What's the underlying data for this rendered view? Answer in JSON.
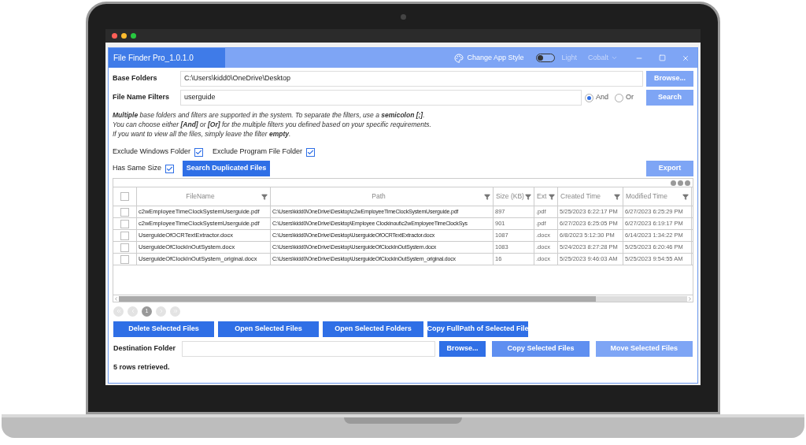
{
  "window": {
    "title": "File Finder Pro_1.0.1.0",
    "style_label": "Change App Style",
    "dark_mode": {
      "on": false,
      "label": "Light"
    },
    "theme": "Cobalt"
  },
  "base_folders": {
    "label": "Base Folders",
    "value": "C:\\Users\\kidd0\\OneDrive\\Desktop",
    "button": "Browse..."
  },
  "filters": {
    "label": "File Name Filters",
    "value": "userguide",
    "options": [
      {
        "label": "And",
        "selected": true
      },
      {
        "label": "Or",
        "selected": false
      }
    ],
    "button": "Search"
  },
  "help": [
    "**Multiple** base folders and filters are supported in the system. To separate the filters, use a **semicolon [;]**.",
    "You can choose either **[And]** or **[Or]** for the multiple filters you defined based on your specific requirements.",
    "If you want to view all the files, simply leave the filter **empty**."
  ],
  "excludes": [
    {
      "label": "Exclude Windows Folder",
      "checked": true
    },
    {
      "label": "Exclude Program File Folder",
      "checked": true
    }
  ],
  "same_size": {
    "label": "Has Same Size",
    "checked": true
  },
  "duplicate_button": "Search Duplicated Files",
  "export_button": "Export",
  "table": {
    "all_checked": false,
    "columns": [
      "FileName",
      "Path",
      "Size (KB)",
      "Ext",
      "Created Time",
      "Modified Time"
    ],
    "rows": [
      {
        "checked": false,
        "cells": [
          "c2wEmployeeTimeClockSystemUserguide.pdf",
          "C:\\Users\\kidd0\\OneDrive\\Desktop\\c2wEmployeeTimeClockSystemUserguide.pdf",
          "897",
          ".pdf",
          "5/25/2023 6:22:17 PM",
          "6/27/2023 6:25:29 PM"
        ]
      },
      {
        "checked": false,
        "cells": [
          "c2wEmployeeTimeClockSystemUserguide.pdf",
          "C:\\Users\\kidd0\\OneDrive\\Desktop\\Employee Clockinout\\c2wEmployeeTimeClockSys",
          "901",
          ".pdf",
          "6/27/2023 6:25:05 PM",
          "6/27/2023 6:19:17 PM"
        ]
      },
      {
        "checked": false,
        "cells": [
          "UserguideOfOCRTextExtractor.docx",
          "C:\\Users\\kidd0\\OneDrive\\Desktop\\UserguideOfOCRTextExtractor.docx",
          "1087",
          ".docx",
          "6/8/2023 5:12:30 PM",
          "6/14/2023 1:34:22 PM"
        ]
      },
      {
        "checked": false,
        "cells": [
          "UserguideOfClockInOutSystem.docx",
          "C:\\Users\\kidd0\\OneDrive\\Desktop\\UserguideOfClockInOutSystem.docx",
          "1083",
          ".docx",
          "5/24/2023 8:27:28 PM",
          "5/25/2023 6:20:46 PM"
        ]
      },
      {
        "checked": false,
        "cells": [
          "UserguideOfClockInOutSystem_original.docx",
          "C:\\Users\\kidd0\\OneDrive\\Desktop\\UserguideOfClockInOutSystem_original.docx",
          "16",
          ".docx",
          "5/25/2023 9:46:03 AM",
          "5/25/2023 9:54:55 AM"
        ]
      }
    ]
  },
  "pager": {
    "pages": [
      {
        "label": "1",
        "selected": true
      }
    ]
  },
  "actions": [
    "Delete Selected Files",
    "Open Selected Files",
    "Open Selected Folders",
    "Copy FullPath of Selected File"
  ],
  "destination": {
    "label": "Destination Folder",
    "button": "Browse...",
    "copy_button": "Copy Selected Files",
    "move_button": "Move Selected Files"
  },
  "status": "5 rows retrieved."
}
